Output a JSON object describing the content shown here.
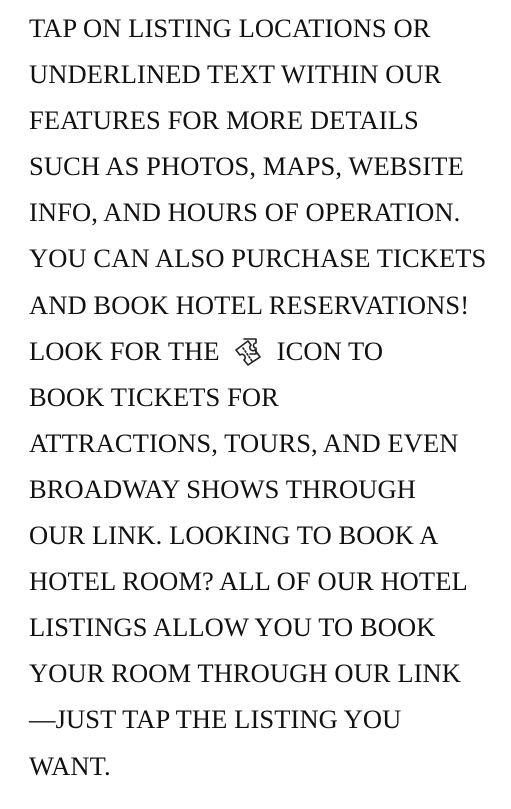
{
  "info": {
    "lines": [
      "TAP ON LISTING LOCATIONS OR",
      "UNDERLINED TEXT WITHIN OUR",
      "FEATURES FOR MORE DETAILS",
      "SUCH AS PHOTOS, MAPS, WEBSITE",
      "INFO, AND HOURS OF OPERATION.",
      "YOU CAN ALSO PURCHASE TICKETS",
      "AND BOOK HOTEL RESERVATIONS!"
    ],
    "icon_line_before": "LOOK FOR THE",
    "icon_line_after": "ICON TO",
    "icon_name": "ticket-icon",
    "lines_after": [
      "BOOK TICKETS FOR",
      "ATTRACTIONS, TOURS, AND EVEN",
      "BROADWAY SHOWS THROUGH",
      "OUR LINK. LOOKING TO BOOK A",
      "HOTEL ROOM? ALL OF OUR HOTEL",
      "LISTINGS ALLOW YOU TO BOOK",
      "YOUR ROOM THROUGH OUR LINK",
      "—JUST TAP THE LISTING YOU",
      "WANT."
    ]
  }
}
